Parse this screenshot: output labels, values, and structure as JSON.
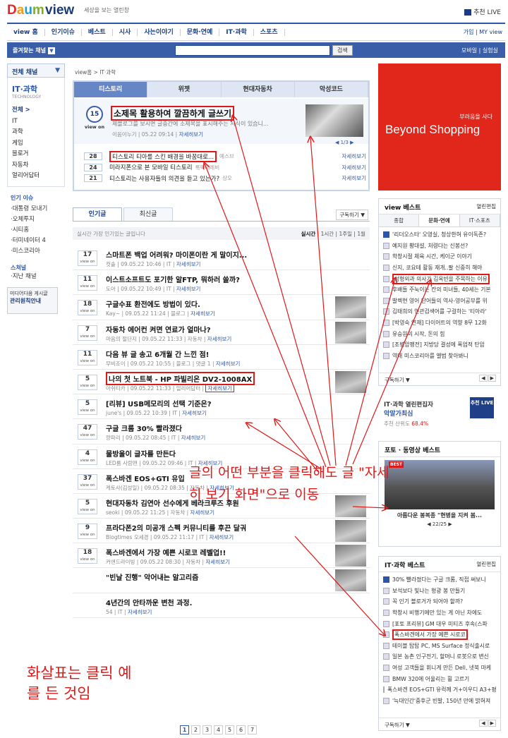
{
  "header": {
    "logo": "Daum",
    "view_logo": "view",
    "tagline": "세상을 보는 열린창",
    "live_label": "추천 LIVE"
  },
  "gnb": {
    "items": [
      "view 홈",
      "인기이슈",
      "베스트",
      "시사",
      "사는이야기",
      "문화·연예",
      "IT·과학",
      "스포츠"
    ],
    "right": "가입 | MY view"
  },
  "search": {
    "fav_label": "즐겨찾는 채널",
    "button": "검색",
    "right": "모바일 | 실험실"
  },
  "left_nav": {
    "header": "전체 채널",
    "section_title": "IT·과학",
    "section_sub": "TECHNOLOGY",
    "items": [
      "전체 >",
      "IT",
      "과학",
      "게임",
      "블로거",
      "자동차",
      "얼리어답터"
    ],
    "issue_title": "인기 이슈",
    "issues": [
      "대통령 모내기",
      "오체투지",
      "시티홈",
      "터미네이터 4",
      "미스코리아"
    ],
    "scrap_title": "스쳐널",
    "scrap_items": [
      "지난 채널"
    ],
    "banner_small": "미디어다음 게시글",
    "banner_big": "관리원칙안내"
  },
  "breadcrumb": "view홈 > IT·과학",
  "featured": {
    "tabs": [
      "티스토리",
      "위젯",
      "현대자동차",
      "악성코드"
    ],
    "count": "15",
    "badge": "view on",
    "title": "소제목 활용하여 깔끔하게 글쓰기",
    "desc": "제블로그를 보시면 글중간에 소제목을 표시해주는 서식이 있습니...",
    "author": "이음이누기",
    "date": "05.22 09:14",
    "more": "자세히보기",
    "pager": "◀ 1/3 ▶",
    "list": [
      {
        "n": "28",
        "title": "티스토리 티아를 스킨 배경을 바꿈대로...",
        "src": "예스브",
        "more": "자세히보기",
        "boxed": true
      },
      {
        "n": "24",
        "title": "미라지폰으로 본 모바일 티스토리",
        "src": "록팩테레비",
        "more": "자세히보기",
        "boxed": false
      },
      {
        "n": "21",
        "title": "티스토리는 사용자들의 의견을 듣고 있는가?",
        "src": "상오",
        "more": "자세히보기",
        "boxed": false
      }
    ]
  },
  "popular": {
    "tabs": [
      "인기글",
      "최신글"
    ],
    "subscribe": "구독하기",
    "filter_note": "실시간 가장 인기있는 글입니다",
    "filter_right": [
      "실시간",
      "1시간",
      "1주일",
      "1월"
    ],
    "rows": [
      {
        "n": "17",
        "title": "스마트폰 백업 어려워? 마이폰이란 게 말이지...",
        "author": "컷솔",
        "date": "09.05.22 10:46",
        "cat": "IT",
        "more": "자세히보기"
      },
      {
        "n": "11",
        "title": "이스트소프트도 포기한 알FTP, 뭐하러 쓸까?",
        "author": "도아",
        "date": "09.05.22 10:49",
        "cat": "IT",
        "more": "자세히보기"
      },
      {
        "n": "18",
        "title": "구글수표 환전에도 방법이 있다.",
        "author": "Kay~",
        "date": "09.05.22 11:24",
        "cat": "블로그",
        "more": "자세히보기",
        "thumb": true
      },
      {
        "n": "7",
        "title": "자동차 에어컨 켜면 연료가 얼마나?",
        "author": "마음의 절단지",
        "date": "09.05.22 11:33",
        "cat": "자동차",
        "more": "자세히보기",
        "thumb": true
      },
      {
        "n": "11",
        "title": "다음 뷰 글 송고 6개월 간 느낀 점!",
        "author": "무비조이",
        "date": "09.05.22 10:55",
        "cat": "블로그",
        "extra": "댓글 1",
        "more": "자세히보기"
      },
      {
        "n": "5",
        "title": "나의 첫 노트북 - HP 파빌리온 DV2-1008AX",
        "author": "아쉬티카",
        "date": "09.05.22 11:33",
        "cat": "얼리어답터",
        "more": "자세히보기",
        "boxed": true,
        "thumb": true
      },
      {
        "n": "5",
        "title": "[리뷰] USB메모리의 선택 기준은?",
        "author": "june's",
        "date": "09.05.22 10:39",
        "cat": "IT",
        "more": "자세히보기"
      },
      {
        "n": "47",
        "title": "구글 크롬 30% 빨라졌다",
        "author": "량파리",
        "date": "09.05.22 08:45",
        "cat": "IT",
        "more": "자세히보기"
      },
      {
        "n": "4",
        "title": "물방울이 글자를 만든다",
        "author": "LED룸 사람맨",
        "date": "09.05.22 09:46",
        "cat": "IT",
        "more": "자세히보기"
      },
      {
        "n": "37",
        "title": "폭스바겐 EOS+GTI 유입",
        "author": "케토사(김성일)",
        "date": "09.05.22 08:35",
        "cat": "자동차",
        "more": "자세히보기"
      },
      {
        "n": "5",
        "title": "현대자동차 김연아 선수에게 베라크루즈 후원",
        "author": "seoki",
        "date": "09.05.22 11:25",
        "cat": "자동차",
        "more": "자세히보기",
        "thumb": true
      },
      {
        "n": "9",
        "title": "프라다폰2의 미공개 스펙 커뮤니티를 후끈 달궈",
        "author": "Blogtimes 오세경",
        "date": "09.05.22 11:17",
        "cat": "IT",
        "more": "자세히보기",
        "thumb": true
      },
      {
        "n": "18",
        "title": "폭스바겐에서 가장 예쁜 시로코 레벨업!!",
        "author": "커엔드라이빙",
        "date": "09.05.22 08:30",
        "cat": "자동차",
        "more": "자세히보기",
        "thumb": true
      },
      {
        "n": "",
        "title": "\"빈날 진행\" 악어내는 알고리즘",
        "author": "",
        "date": "",
        "cat": "",
        "more": "",
        "thumb": true
      },
      {
        "n": "",
        "title": "4년간의 안타까운 변천 과정.",
        "author": "54",
        "date": "",
        "cat": "IT",
        "more": "자세히보기"
      }
    ],
    "pages": [
      "1",
      "2",
      "3",
      "4",
      "5",
      "6",
      "7"
    ]
  },
  "right": {
    "ad_small": "부러움을 사다",
    "ad_big": "Beyond Shopping",
    "best_title": "view 베스트",
    "best_all": "열린편집",
    "best_tabs": [
      "종합",
      "문화·연예",
      "IT·스포츠"
    ],
    "best_items": [
      {
        "t": "'리더오스타' 오영실, 청상한혀 유이독존?"
      },
      {
        "t": "예지원 황대설, 처령다는 신봉선?"
      },
      {
        "t": "학창시절 체육 시간, 케이군 이야기"
      },
      {
        "t": "신지, 코요테 활동 재개..팔 신중히 해야"
      },
      {
        "t": "성형외과 의사가 김옥빈을 주목하는 이유",
        "boxed": true
      },
      {
        "t": "후배들 주눅이는 칸의 미녀들, 40세는 기본"
      },
      {
        "t": "발렉현 영어 단어들의 역사-영어공부를 위"
      },
      {
        "t": "김태희의 연관검색어를 구걸하는 '티아라'"
      },
      {
        "t": "[박영숙 연재] 다이어트의 역향 8무 12화"
      },
      {
        "t": "유승원의 시작, 돈의 힘"
      },
      {
        "t": "[조병암팽전] 지방당 결성에 폭업적 탄압"
      },
      {
        "t": "역대 미스코리아를 앨범 찾아봐니"
      }
    ],
    "best_footer": "구독하기",
    "edit_title": "IT·과학 열린편집자",
    "edit_name": "악말가최심",
    "edit_sub": "추천 산위도",
    "edit_pct": "68.4%",
    "edit_btn": "추천 LIVE",
    "photo_title": "포토 · 동영상 베스트",
    "photo_badge": "BEST",
    "photo_caption": "아름다운 봉복종 \"현병을 지켜 봄...",
    "photo_pager": "22/25",
    "itbest_title": "IT·과학 베스트",
    "itbest_all": "열린편집",
    "itbest_items": [
      {
        "t": "30% 빨라졌다는 구글 크롬, 직접 써보니"
      },
      {
        "t": "보석보다 빛나는 형광 봉 만들기"
      },
      {
        "t": "꼭 인기 블로거가 되어야 할까?"
      },
      {
        "t": "학창시 비행기에만 있는 게 아닌 차에도"
      },
      {
        "t": "[포토 프리뷰] GM 대우 미티즈 후속(스파"
      },
      {
        "t": "폭스바겐에서 가장 예쁜 시로코",
        "boxed": true
      },
      {
        "t": "테이블 탑탑 PC, MS Surface 정식출시로"
      },
      {
        "t": "일본 농촌 인구전기, 할머니 로봇으로 변신"
      },
      {
        "t": "여성 고객들을 휘니게 만든 Dell, 넷북 마케"
      },
      {
        "t": "BMW 320에 어울리는 휠 고르기"
      },
      {
        "t": "폭스바겐 EOS+GTI 유럭께 거+이우디 A3+평"
      },
      {
        "t": "'늑대인간'중후군 빈발, 150년 만에 밝혀져"
      }
    ],
    "itbest_footer": "구독하기"
  },
  "annotations": {
    "main": "글의 어떤 부분을 클릭해도 글 \"자세히 보기 화면\"으로 이동",
    "note": "화살표는 클릭 예를 든 것임"
  }
}
